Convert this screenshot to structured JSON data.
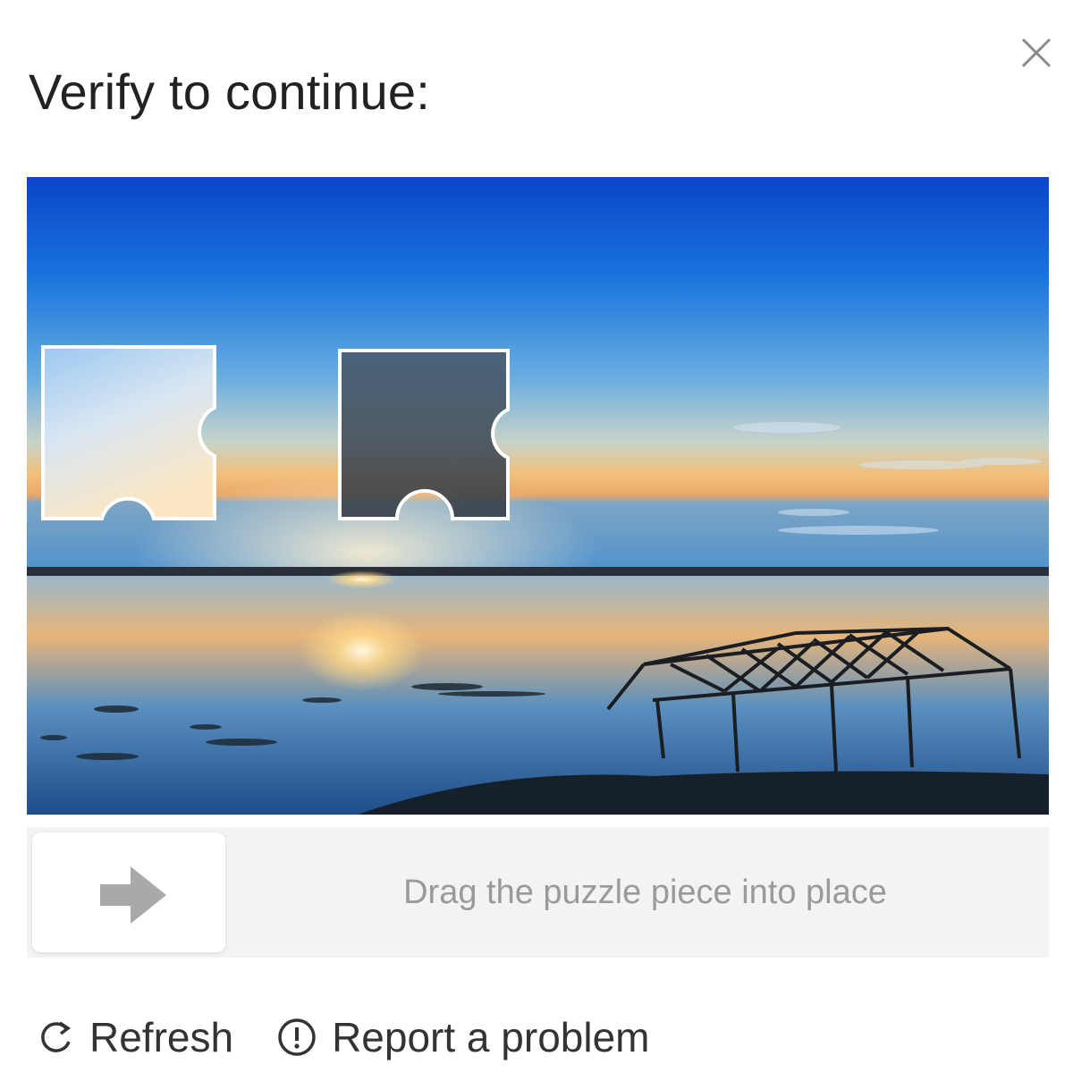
{
  "dialog": {
    "title": "Verify to continue:"
  },
  "captcha": {
    "icons": {
      "close": "close-icon",
      "slider": "arrow-right-icon"
    },
    "slider": {
      "hint": "Drag the puzzle piece into place",
      "progress": 0
    }
  },
  "footer": {
    "refresh_label": "Refresh",
    "refresh_icon": "refresh-icon",
    "report_label": "Report a problem",
    "report_icon": "exclamation-circle-icon"
  },
  "colors": {
    "title": "#222222",
    "track": "#f2f3f5",
    "hint": "#9a9a9a",
    "sky_top": "#0a4fd6",
    "sunset": "#f5c27a"
  }
}
